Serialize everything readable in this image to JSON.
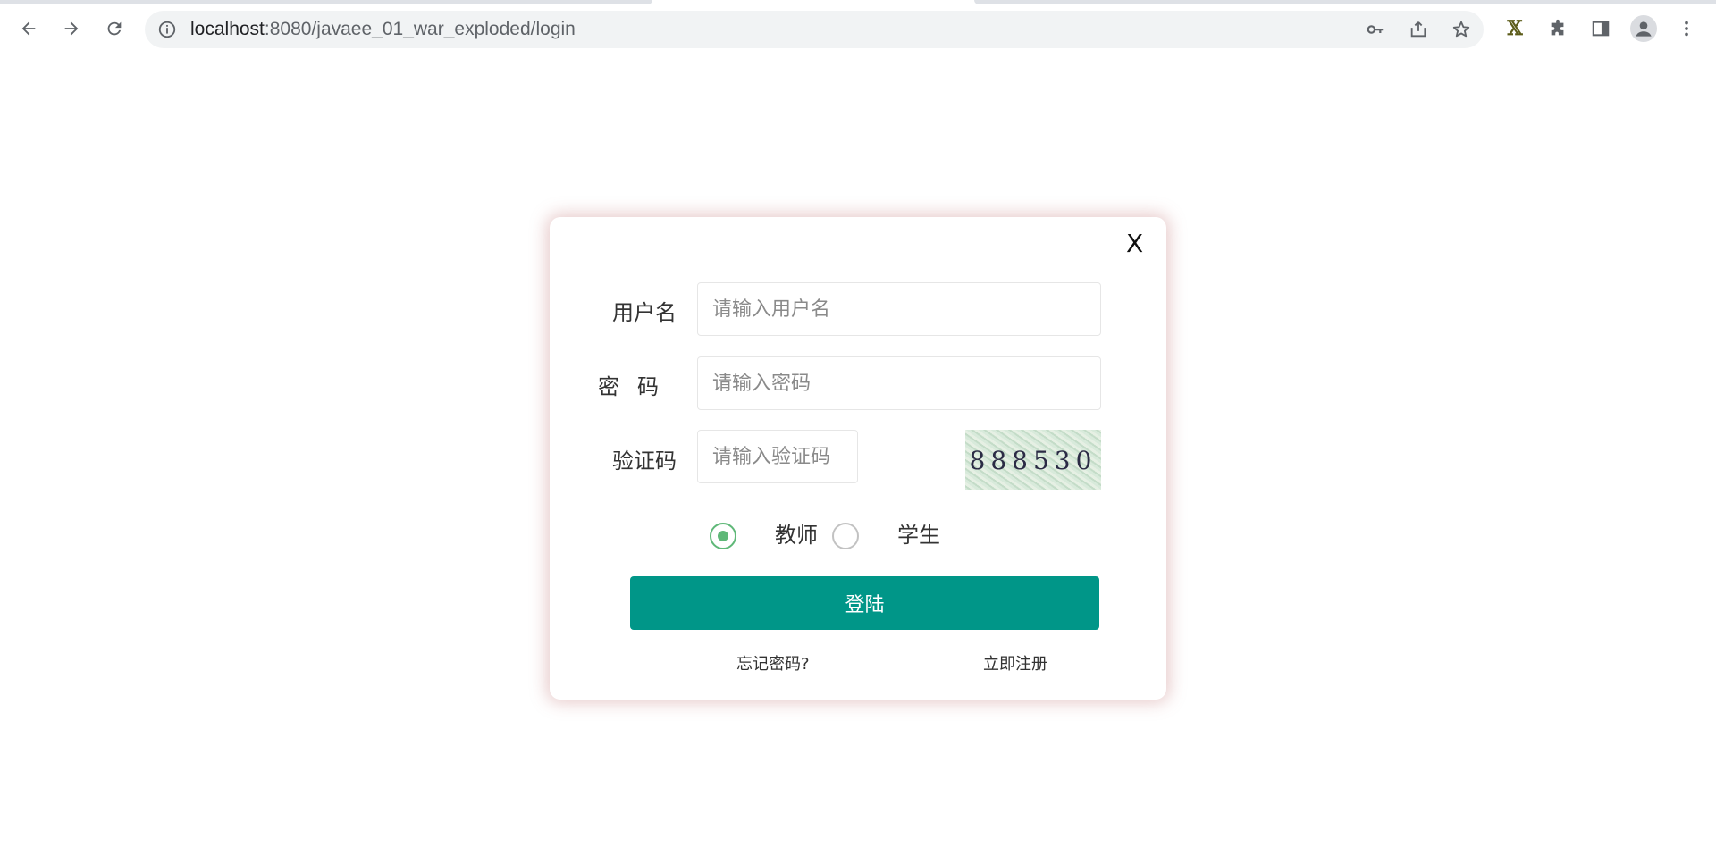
{
  "browser": {
    "url_host": "localhost",
    "url_path": ":8080/javaee_01_war_exploded/login",
    "icons": [
      "back-arrow-icon",
      "forward-arrow-icon",
      "reload-icon",
      "info-icon",
      "key-icon",
      "share-icon",
      "star-icon",
      "extension-x-icon",
      "puzzle-icon",
      "side-panel-icon",
      "profile-icon",
      "menu-dots-icon"
    ],
    "extension_x_label": "𝕏"
  },
  "login": {
    "close_label": "X",
    "username_label": "用户名",
    "username_placeholder": "请输入用户名",
    "password_label": "密码",
    "password_placeholder": "请输入密码",
    "captcha_label": "验证码",
    "captcha_placeholder": "请输入验证码",
    "captcha_text": "888530",
    "role_teacher": "教师",
    "role_student": "学生",
    "selected_role": "teacher",
    "submit_label": "登陆",
    "forgot_label": "忘记密码?",
    "register_label": "立即注册"
  },
  "colors": {
    "primary": "#009688",
    "radio_checked": "#5fb878"
  }
}
